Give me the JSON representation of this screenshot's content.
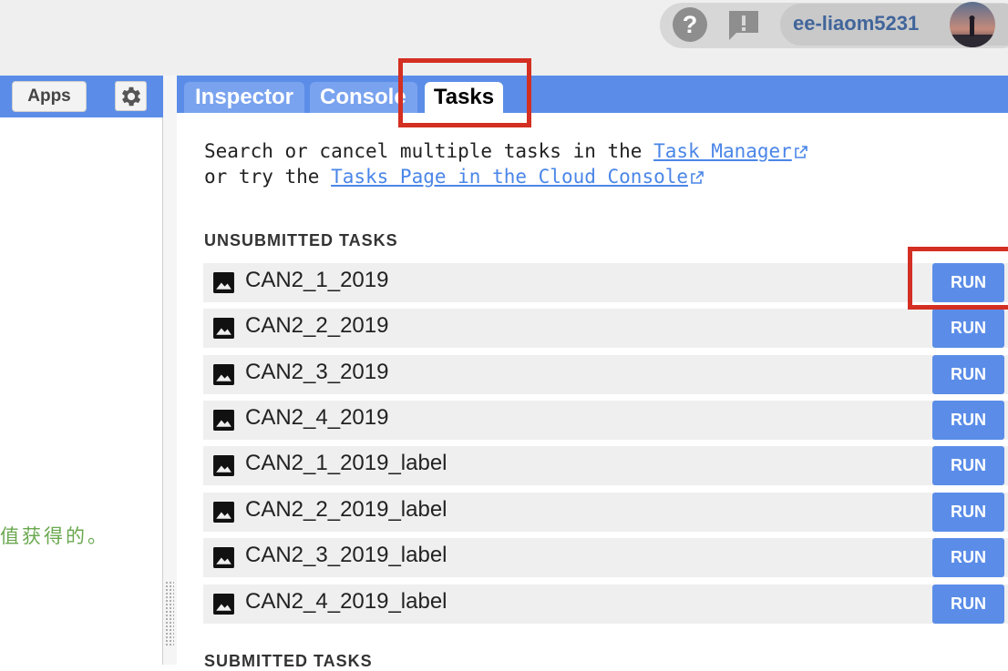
{
  "account": {
    "username": "ee-liaom5231",
    "help_icon": "help-icon",
    "feedback_icon": "feedback-icon"
  },
  "left_panel": {
    "apps_label": "Apps",
    "settings_icon": "gear-icon",
    "truncated_text": "值获得的。"
  },
  "tabs": [
    {
      "label": "Inspector",
      "active": false
    },
    {
      "label": "Console",
      "active": false
    },
    {
      "label": "Tasks",
      "active": true
    }
  ],
  "intro": {
    "line1_prefix": "Search or cancel multiple tasks in the ",
    "line1_link": "Task Manager",
    "line2_prefix": "or try the ",
    "line2_link": "Tasks Page in the Cloud Console"
  },
  "unsubmitted": {
    "title": "UNSUBMITTED TASKS",
    "tasks": [
      {
        "name": "CAN2_1_2019",
        "action": "RUN"
      },
      {
        "name": "CAN2_2_2019",
        "action": "RUN"
      },
      {
        "name": "CAN2_3_2019",
        "action": "RUN"
      },
      {
        "name": "CAN2_4_2019",
        "action": "RUN"
      },
      {
        "name": "CAN2_1_2019_label",
        "action": "RUN"
      },
      {
        "name": "CAN2_2_2019_label",
        "action": "RUN"
      },
      {
        "name": "CAN2_3_2019_label",
        "action": "RUN"
      },
      {
        "name": "CAN2_4_2019_label",
        "action": "RUN"
      }
    ]
  },
  "submitted": {
    "title": "SUBMITTED TASKS"
  },
  "colors": {
    "accent": "#5b8de8",
    "highlight": "#d32f22",
    "link": "#4a86e8",
    "left_text": "#6aa84f"
  }
}
